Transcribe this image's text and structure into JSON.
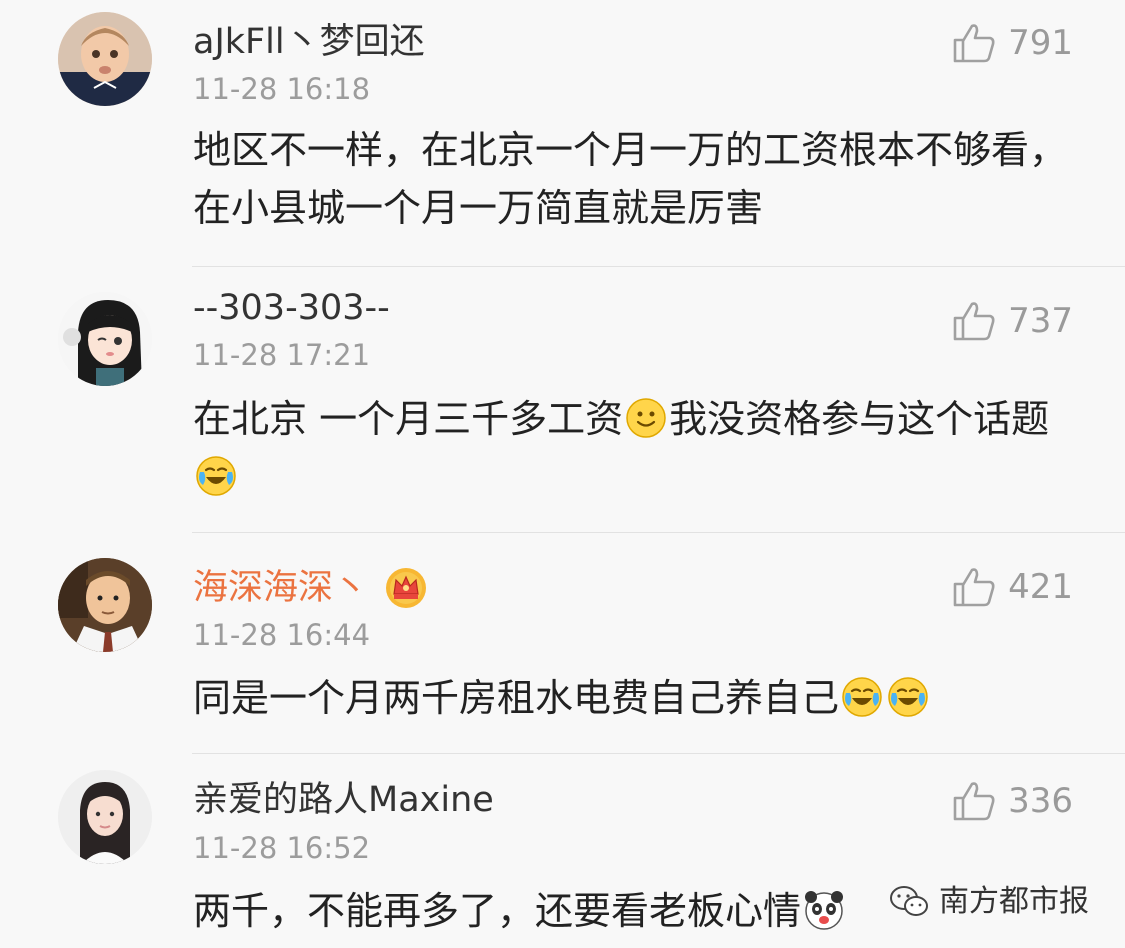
{
  "comments": [
    {
      "username": "aJkFll丶梦回还",
      "time": "11-28 16:18",
      "text_parts": [
        "地区不一样，在北京一个月一万的工资根本不够看，在小县城一个月一万简直就是厉害"
      ],
      "likes": "791",
      "avatar": "baby-avatar"
    },
    {
      "username": "--303-303--",
      "time": "11-28 17:21",
      "text_parts": [
        "在北京 一个月三千多工资",
        "我没资格参与这个话题"
      ],
      "emojis": [
        "smile-emoji",
        "laugh-cry-emoji"
      ],
      "likes": "737",
      "avatar": "anime-girl-avatar"
    },
    {
      "username": "海深海深丶",
      "time": "11-28 16:44",
      "text_parts": [
        "同是一个月两千房租水电费自己养自己"
      ],
      "emojis": [
        "laugh-cry-emoji",
        "laugh-cry-emoji"
      ],
      "likes": "421",
      "avatar": "cartoon-man-avatar",
      "badge": "crown-icon",
      "name_color": "#eb7340"
    },
    {
      "username": "亲爱的路人Maxine",
      "time": "11-28 16:52",
      "text_parts": [
        "两千，不能再多了，还要看老板心情"
      ],
      "emojis": [
        "panda-emoji"
      ],
      "likes": "336",
      "avatar": "woman-avatar"
    }
  ],
  "watermark": {
    "text": "南方都市报",
    "icon": "wechat-icon"
  },
  "colors": {
    "username": "#333333",
    "vip_username": "#eb7340",
    "time": "#9c9c9c",
    "like": "#9a9a9a"
  }
}
